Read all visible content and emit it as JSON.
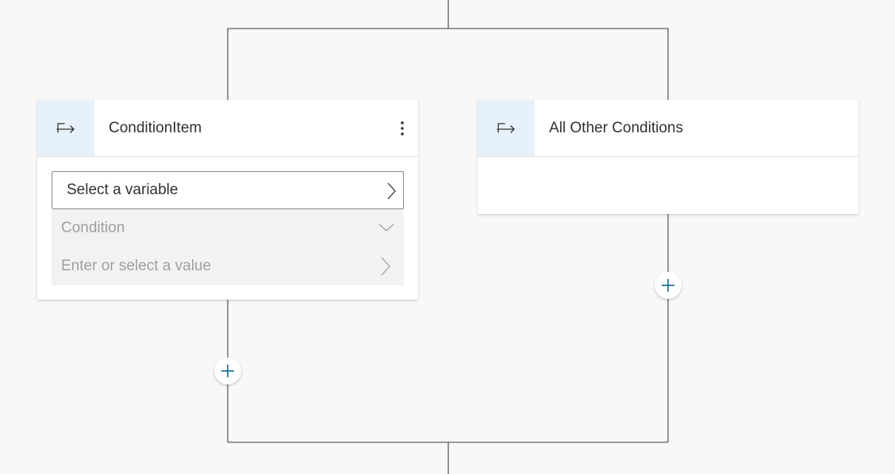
{
  "branches": {
    "condition_item": {
      "title": "ConditionItem",
      "variable_placeholder": "Select a variable",
      "condition_placeholder": "Condition",
      "value_placeholder": "Enter or select a value"
    },
    "all_other": {
      "title": "All Other Conditions"
    }
  },
  "icons": {
    "branch": "branch-icon",
    "more": "more-options-icon",
    "add": "add-node-icon",
    "chevron_right": "chevron-right-icon",
    "chevron_down": "chevron-down-icon"
  },
  "colors": {
    "accent": "#0f6cbd",
    "icon_bg": "#e7f1fc",
    "canvas": "#f9f8f7",
    "add_icon": "#0e6a8a"
  }
}
